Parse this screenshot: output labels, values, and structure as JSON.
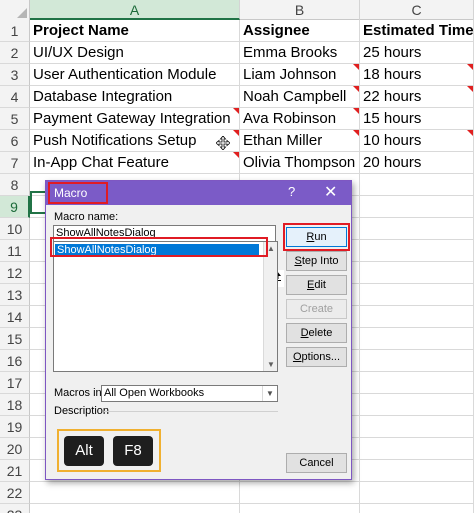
{
  "spreadsheet": {
    "columns": [
      "A",
      "B",
      "C"
    ],
    "active_column": "A",
    "rows": [
      "1",
      "2",
      "3",
      "4",
      "5",
      "6",
      "7",
      "8",
      "9",
      "10",
      "11",
      "12",
      "13",
      "14",
      "15",
      "16",
      "17",
      "18",
      "19",
      "20",
      "21",
      "22",
      "23"
    ],
    "active_row": "9",
    "header": [
      "Project Name",
      "Assignee",
      "Estimated Time"
    ],
    "data": [
      [
        "UI/UX Design",
        "Emma Brooks",
        "25 hours"
      ],
      [
        "User Authentication Module",
        "Liam Johnson",
        "18 hours"
      ],
      [
        "Database Integration",
        "Noah Campbell",
        "22 hours"
      ],
      [
        "Payment Gateway Integration",
        "Ava Robinson",
        "15 hours"
      ],
      [
        "Push Notifications Setup",
        "Ethan Miller",
        "10 hours"
      ],
      [
        "In-App Chat Feature",
        "Olivia Thompson",
        "20 hours"
      ]
    ]
  },
  "dialog": {
    "title": "Macro",
    "help": "?",
    "close": "✕",
    "macro_name_label": "Macro name:",
    "macro_name_value": "ShowAllNotesDialog",
    "list_items": [
      "ShowAllNotesDialog"
    ],
    "buttons": {
      "run": "Run",
      "step_into": "Step Into",
      "edit": "Edit",
      "create": "Create",
      "delete": "Delete",
      "options": "Options...",
      "cancel": "Cancel"
    },
    "macros_in_label": "Macros in:",
    "macros_in_value": "All Open Workbooks",
    "description_label": "Description"
  },
  "shortcut_keys": [
    "Alt",
    "F8"
  ],
  "colors": {
    "titlebar": "#7b5bc7",
    "highlight_red": "#e01b24",
    "highlight_orange": "#f0b030",
    "selection_blue": "#0078d7",
    "excel_green": "#217346"
  }
}
